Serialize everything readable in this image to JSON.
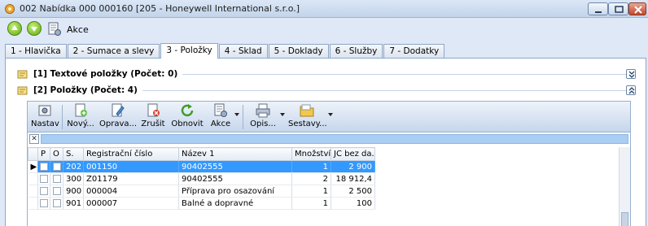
{
  "window": {
    "title": "002 Nabídka 000 000160 [205 - Honeywell International s.r.o.]"
  },
  "main_toolbar": {
    "akce_label": "Akce"
  },
  "tabs": [
    {
      "label": "1 - Hlavička"
    },
    {
      "label": "2 - Sumace a slevy"
    },
    {
      "label": "3 - Položky",
      "active": true
    },
    {
      "label": "4 - Sklad"
    },
    {
      "label": "5 - Doklady"
    },
    {
      "label": "6 - Služby"
    },
    {
      "label": "7 - Dodatky"
    }
  ],
  "sections": {
    "text_items": {
      "title": "[1] Textové položky (Počet: 0)"
    },
    "items": {
      "title": "[2] Položky (Počet: 4)"
    }
  },
  "grid_toolbar": {
    "nastav": "Nastav",
    "novy": "Nový...",
    "oprava": "Oprava...",
    "zrusit": "Zrušit",
    "obnovit": "Obnovit",
    "akce": "Akce",
    "opis": "Opis...",
    "sestavy": "Sestavy..."
  },
  "filter": {
    "clear_label": "✕"
  },
  "grid": {
    "columns": {
      "p": "P",
      "o": "O",
      "s": "S.",
      "reg": "Registrační číslo",
      "name": "Název 1",
      "qty": "Množství",
      "price": "JC bez da..."
    },
    "rows": [
      {
        "s": "202",
        "reg": "001150",
        "name": "90402555",
        "qty": "1",
        "price": "2 900"
      },
      {
        "s": "300",
        "reg": "Z01179",
        "name": "90402555",
        "qty": "2",
        "price": "18 912,4"
      },
      {
        "s": "900",
        "reg": "000004",
        "name": "Příprava pro osazování",
        "qty": "1",
        "price": "2 500"
      },
      {
        "s": "901",
        "reg": "000007",
        "name": "Balné a dopravné",
        "qty": "1",
        "price": "100"
      }
    ]
  },
  "colors": {
    "selection": "#3399ff",
    "panel": "#dfe8f6"
  }
}
